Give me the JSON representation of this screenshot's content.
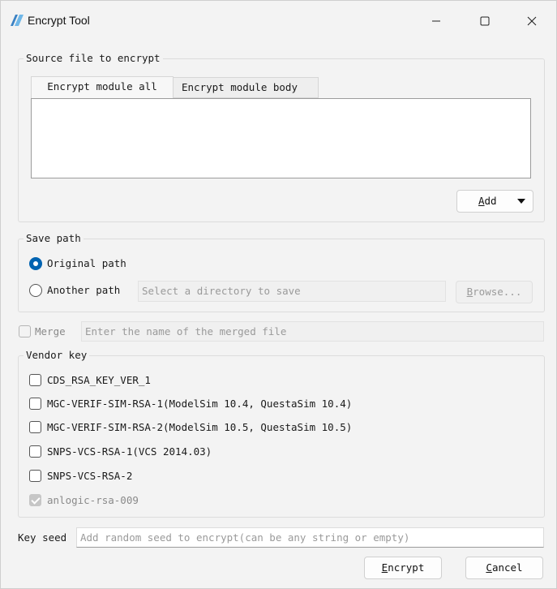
{
  "window": {
    "title": "Encrypt Tool",
    "controls": {
      "minimize": "—",
      "maximize": "☐",
      "close": "✕"
    }
  },
  "source": {
    "group_title": "Source file to encrypt",
    "tabs": [
      {
        "label": "Encrypt module all",
        "active": true
      },
      {
        "label": "Encrypt module body",
        "active": false
      }
    ],
    "add_button": "Add",
    "add_button_mnemonic": "A",
    "add_button_rest": "dd"
  },
  "save_path": {
    "group_title": "Save path",
    "original_label": "Original path",
    "original_selected": true,
    "another_label": "Another path",
    "another_placeholder": "Select a directory to save",
    "browse_mnemonic": "B",
    "browse_rest": "rowse..."
  },
  "merge": {
    "label": "Merge",
    "placeholder": "Enter the name of the merged file",
    "checked": false
  },
  "vendor_key": {
    "group_title": "Vendor key",
    "items": [
      {
        "label": "CDS_RSA_KEY_VER_1",
        "checked": false,
        "enabled": true
      },
      {
        "label": "MGC-VERIF-SIM-RSA-1(ModelSim 10.4, QuestaSim 10.4)",
        "checked": false,
        "enabled": true
      },
      {
        "label": "MGC-VERIF-SIM-RSA-2(ModelSim 10.5, QuestaSim 10.5)",
        "checked": false,
        "enabled": true
      },
      {
        "label": "SNPS-VCS-RSA-1(VCS 2014.03)",
        "checked": false,
        "enabled": true
      },
      {
        "label": "SNPS-VCS-RSA-2",
        "checked": false,
        "enabled": true
      },
      {
        "label": "anlogic-rsa-009",
        "checked": true,
        "enabled": false
      }
    ]
  },
  "key_seed": {
    "label": "Key seed",
    "placeholder": "Add random seed to encrypt(can be any string or empty)"
  },
  "actions": {
    "encrypt_mnemonic": "E",
    "encrypt_rest": "ncrypt",
    "cancel_mnemonic": "C",
    "cancel_rest": "ancel"
  },
  "colors": {
    "accent": "#0063b1",
    "window_bg": "#f3f3f3"
  }
}
